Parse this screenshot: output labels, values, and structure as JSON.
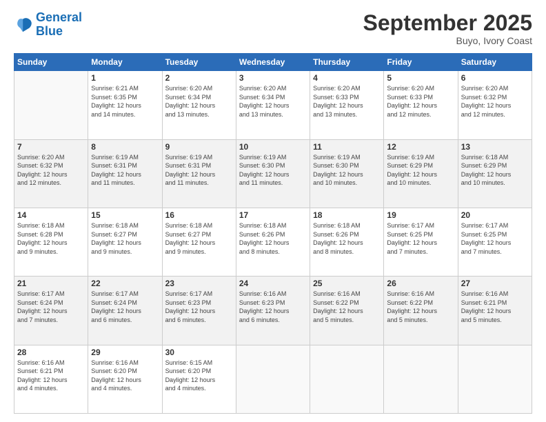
{
  "logo": {
    "line1": "General",
    "line2": "Blue"
  },
  "title": "September 2025",
  "subtitle": "Buyo, Ivory Coast",
  "days_of_week": [
    "Sunday",
    "Monday",
    "Tuesday",
    "Wednesday",
    "Thursday",
    "Friday",
    "Saturday"
  ],
  "weeks": [
    [
      null,
      {
        "day": 1,
        "sunrise": "6:21 AM",
        "sunset": "6:35 PM",
        "daylight": "12 hours and 14 minutes."
      },
      {
        "day": 2,
        "sunrise": "6:20 AM",
        "sunset": "6:34 PM",
        "daylight": "12 hours and 13 minutes."
      },
      {
        "day": 3,
        "sunrise": "6:20 AM",
        "sunset": "6:34 PM",
        "daylight": "12 hours and 13 minutes."
      },
      {
        "day": 4,
        "sunrise": "6:20 AM",
        "sunset": "6:33 PM",
        "daylight": "12 hours and 13 minutes."
      },
      {
        "day": 5,
        "sunrise": "6:20 AM",
        "sunset": "6:33 PM",
        "daylight": "12 hours and 12 minutes."
      },
      {
        "day": 6,
        "sunrise": "6:20 AM",
        "sunset": "6:32 PM",
        "daylight": "12 hours and 12 minutes."
      }
    ],
    [
      {
        "day": 7,
        "sunrise": "6:20 AM",
        "sunset": "6:32 PM",
        "daylight": "12 hours and 12 minutes."
      },
      {
        "day": 8,
        "sunrise": "6:19 AM",
        "sunset": "6:31 PM",
        "daylight": "12 hours and 11 minutes."
      },
      {
        "day": 9,
        "sunrise": "6:19 AM",
        "sunset": "6:31 PM",
        "daylight": "12 hours and 11 minutes."
      },
      {
        "day": 10,
        "sunrise": "6:19 AM",
        "sunset": "6:30 PM",
        "daylight": "12 hours and 11 minutes."
      },
      {
        "day": 11,
        "sunrise": "6:19 AM",
        "sunset": "6:30 PM",
        "daylight": "12 hours and 10 minutes."
      },
      {
        "day": 12,
        "sunrise": "6:19 AM",
        "sunset": "6:29 PM",
        "daylight": "12 hours and 10 minutes."
      },
      {
        "day": 13,
        "sunrise": "6:18 AM",
        "sunset": "6:29 PM",
        "daylight": "12 hours and 10 minutes."
      }
    ],
    [
      {
        "day": 14,
        "sunrise": "6:18 AM",
        "sunset": "6:28 PM",
        "daylight": "12 hours and 9 minutes."
      },
      {
        "day": 15,
        "sunrise": "6:18 AM",
        "sunset": "6:27 PM",
        "daylight": "12 hours and 9 minutes."
      },
      {
        "day": 16,
        "sunrise": "6:18 AM",
        "sunset": "6:27 PM",
        "daylight": "12 hours and 9 minutes."
      },
      {
        "day": 17,
        "sunrise": "6:18 AM",
        "sunset": "6:26 PM",
        "daylight": "12 hours and 8 minutes."
      },
      {
        "day": 18,
        "sunrise": "6:18 AM",
        "sunset": "6:26 PM",
        "daylight": "12 hours and 8 minutes."
      },
      {
        "day": 19,
        "sunrise": "6:17 AM",
        "sunset": "6:25 PM",
        "daylight": "12 hours and 7 minutes."
      },
      {
        "day": 20,
        "sunrise": "6:17 AM",
        "sunset": "6:25 PM",
        "daylight": "12 hours and 7 minutes."
      }
    ],
    [
      {
        "day": 21,
        "sunrise": "6:17 AM",
        "sunset": "6:24 PM",
        "daylight": "12 hours and 7 minutes."
      },
      {
        "day": 22,
        "sunrise": "6:17 AM",
        "sunset": "6:24 PM",
        "daylight": "12 hours and 6 minutes."
      },
      {
        "day": 23,
        "sunrise": "6:17 AM",
        "sunset": "6:23 PM",
        "daylight": "12 hours and 6 minutes."
      },
      {
        "day": 24,
        "sunrise": "6:16 AM",
        "sunset": "6:23 PM",
        "daylight": "12 hours and 6 minutes."
      },
      {
        "day": 25,
        "sunrise": "6:16 AM",
        "sunset": "6:22 PM",
        "daylight": "12 hours and 5 minutes."
      },
      {
        "day": 26,
        "sunrise": "6:16 AM",
        "sunset": "6:22 PM",
        "daylight": "12 hours and 5 minutes."
      },
      {
        "day": 27,
        "sunrise": "6:16 AM",
        "sunset": "6:21 PM",
        "daylight": "12 hours and 5 minutes."
      }
    ],
    [
      {
        "day": 28,
        "sunrise": "6:16 AM",
        "sunset": "6:21 PM",
        "daylight": "12 hours and 4 minutes."
      },
      {
        "day": 29,
        "sunrise": "6:16 AM",
        "sunset": "6:20 PM",
        "daylight": "12 hours and 4 minutes."
      },
      {
        "day": 30,
        "sunrise": "6:15 AM",
        "sunset": "6:20 PM",
        "daylight": "12 hours and 4 minutes."
      },
      null,
      null,
      null,
      null
    ]
  ]
}
